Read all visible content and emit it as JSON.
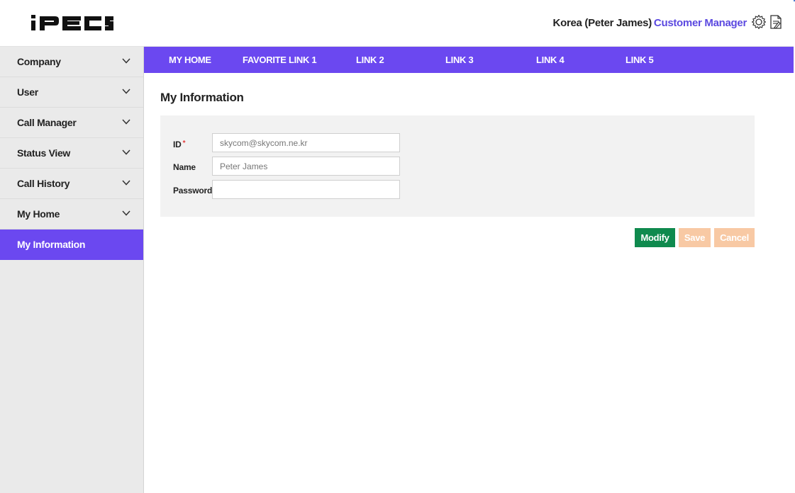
{
  "header": {
    "logo_text": "iPECS",
    "user_name": "Korea (Peter James)",
    "role": "Customer Manager",
    "settings_icon": "gear-icon",
    "doc_icon": "document-icon"
  },
  "sidebar": {
    "items": [
      {
        "label": "Company",
        "expandable": true
      },
      {
        "label": "User",
        "expandable": true
      },
      {
        "label": "Call Manager",
        "expandable": true
      },
      {
        "label": "Status View",
        "expandable": true
      },
      {
        "label": "Call History",
        "expandable": true
      },
      {
        "label": "My Home",
        "expandable": true
      },
      {
        "label": "My Information",
        "expandable": false,
        "active": true
      }
    ]
  },
  "topnav": {
    "links": [
      "MY HOME",
      "FAVORITE LINK 1",
      "LINK 2",
      "LINK 3",
      "LINK 4",
      "LINK 5"
    ]
  },
  "main": {
    "title": "My Information",
    "form": {
      "id_label": "ID",
      "id_required_mark": "*",
      "id_value": "skycom@skycom.ne.kr",
      "name_label": "Name",
      "name_value": "Peter James",
      "password_label": "Password",
      "password_value": ""
    },
    "buttons": {
      "modify": "Modify",
      "save": "Save",
      "cancel": "Cancel"
    }
  },
  "colors": {
    "accent": "#6b48f0",
    "modify_button": "#0f8a4e",
    "disabled_button": "#f8c9a4",
    "role_text": "#5b49e0"
  }
}
